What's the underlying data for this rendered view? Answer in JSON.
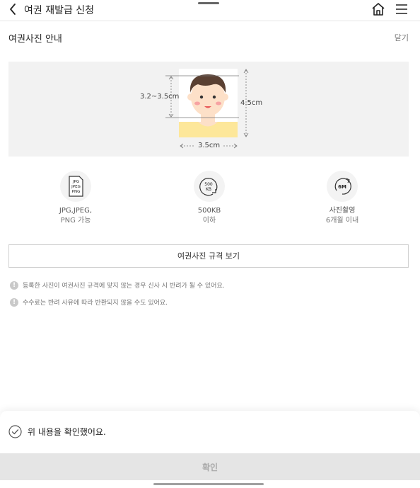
{
  "header": {
    "title": "여권 재발급 신청",
    "back_icon": "chevron-left-icon",
    "home_icon": "home-icon",
    "menu_icon": "hamburger-menu-icon"
  },
  "guide": {
    "title": "여권사진 안내",
    "collapse_label": "닫기"
  },
  "photo_diagram": {
    "face_height_label": "3.2~3.5cm",
    "photo_height_label": "4.5cm",
    "photo_width_label": "3.5cm",
    "colors": {
      "shirt": "#fde79a",
      "face": "#fde0c8",
      "hair": "#5a4032",
      "cheek": "#f7a3a3"
    }
  },
  "specs": [
    {
      "icon": "file-format-icon",
      "icon_text": [
        "JPG",
        "JPEG",
        "PNG"
      ],
      "line1": "JPG,JPEG,",
      "line2": "PNG 가능"
    },
    {
      "icon": "file-size-icon",
      "icon_text": [
        "500",
        "KB"
      ],
      "line1": "500KB",
      "line2": "이하"
    },
    {
      "icon": "six-months-icon",
      "icon_text": [
        "6M"
      ],
      "line1": "사진촬영",
      "line2": "6개월 이내"
    }
  ],
  "rules_button_label": "여권사진 규격 보기",
  "notices": [
    "등록한 사진이 여권사진 규격에 맞지 않는 경우 신사 시 반려가 될 수 있어요.",
    "수수료는 반려 사유에 따라 반환되지 않을 수도 있어요."
  ],
  "bottom": {
    "check_label": "위 내용을 확인했어요.",
    "confirm_label": "확인"
  }
}
